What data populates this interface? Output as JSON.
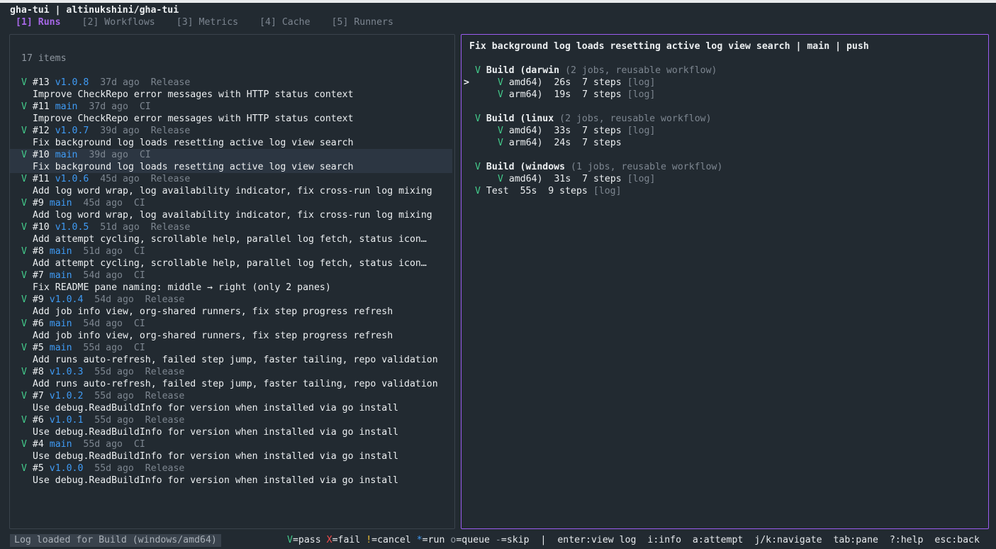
{
  "app_title": "gha-tui | altinukshini/gha-tui",
  "tabs": [
    {
      "label": "[1] Runs",
      "active": true
    },
    {
      "label": "[2] Workflows",
      "active": false
    },
    {
      "label": "[3] Metrics",
      "active": false
    },
    {
      "label": "[4] Cache",
      "active": false
    },
    {
      "label": "[5] Runners",
      "active": false
    }
  ],
  "runs": {
    "count_label": "17 items",
    "selected_index": 3,
    "items": [
      {
        "status": "V",
        "number": "#13",
        "ref": "v1.0.8",
        "age": "37d ago",
        "workflow": "Release",
        "message": "Improve CheckRepo error messages with HTTP status context"
      },
      {
        "status": "V",
        "number": "#11",
        "ref": "main",
        "age": "37d ago",
        "workflow": "CI",
        "message": "Improve CheckRepo error messages with HTTP status context"
      },
      {
        "status": "V",
        "number": "#12",
        "ref": "v1.0.7",
        "age": "39d ago",
        "workflow": "Release",
        "message": "Fix background log loads resetting active log view search"
      },
      {
        "status": "V",
        "number": "#10",
        "ref": "main",
        "age": "39d ago",
        "workflow": "CI",
        "message": "Fix background log loads resetting active log view search"
      },
      {
        "status": "V",
        "number": "#11",
        "ref": "v1.0.6",
        "age": "45d ago",
        "workflow": "Release",
        "message": "Add log word wrap, log availability indicator, fix cross-run log mixing"
      },
      {
        "status": "V",
        "number": "#9",
        "ref": "main",
        "age": "45d ago",
        "workflow": "CI",
        "message": "Add log word wrap, log availability indicator, fix cross-run log mixing"
      },
      {
        "status": "V",
        "number": "#10",
        "ref": "v1.0.5",
        "age": "51d ago",
        "workflow": "Release",
        "message": "Add attempt cycling, scrollable help, parallel log fetch, status icon…"
      },
      {
        "status": "V",
        "number": "#8",
        "ref": "main",
        "age": "51d ago",
        "workflow": "CI",
        "message": "Add attempt cycling, scrollable help, parallel log fetch, status icon…"
      },
      {
        "status": "V",
        "number": "#7",
        "ref": "main",
        "age": "54d ago",
        "workflow": "CI",
        "message": "Fix README pane naming: middle → right (only 2 panes)"
      },
      {
        "status": "V",
        "number": "#9",
        "ref": "v1.0.4",
        "age": "54d ago",
        "workflow": "Release",
        "message": "Add job info view, org-shared runners, fix step progress refresh"
      },
      {
        "status": "V",
        "number": "#6",
        "ref": "main",
        "age": "54d ago",
        "workflow": "CI",
        "message": "Add job info view, org-shared runners, fix step progress refresh"
      },
      {
        "status": "V",
        "number": "#5",
        "ref": "main",
        "age": "55d ago",
        "workflow": "CI",
        "message": "Add runs auto-refresh, failed step jump, faster tailing, repo validation"
      },
      {
        "status": "V",
        "number": "#8",
        "ref": "v1.0.3",
        "age": "55d ago",
        "workflow": "Release",
        "message": "Add runs auto-refresh, failed step jump, faster tailing, repo validation"
      },
      {
        "status": "V",
        "number": "#7",
        "ref": "v1.0.2",
        "age": "55d ago",
        "workflow": "Release",
        "message": "Use debug.ReadBuildInfo for version when installed via go install"
      },
      {
        "status": "V",
        "number": "#6",
        "ref": "v1.0.1",
        "age": "55d ago",
        "workflow": "Release",
        "message": "Use debug.ReadBuildInfo for version when installed via go install"
      },
      {
        "status": "V",
        "number": "#4",
        "ref": "main",
        "age": "55d ago",
        "workflow": "CI",
        "message": "Use debug.ReadBuildInfo for version when installed via go install"
      },
      {
        "status": "V",
        "number": "#5",
        "ref": "v1.0.0",
        "age": "55d ago",
        "workflow": "Release",
        "message": "Use debug.ReadBuildInfo for version when installed via go install"
      }
    ]
  },
  "detail": {
    "header": "Fix background log loads resetting active log view search | main | push",
    "cursor": ">",
    "groups": [
      {
        "status": "V",
        "name": "Build (darwin",
        "meta": "(2 jobs, reusable workflow)",
        "jobs": [
          {
            "status": "V",
            "name": "amd64)",
            "duration": "26s",
            "steps": "7 steps",
            "log": "[log]",
            "cursor": true
          },
          {
            "status": "V",
            "name": "arm64)",
            "duration": "19s",
            "steps": "7 steps",
            "log": "[log]",
            "cursor": false
          }
        ]
      },
      {
        "status": "V",
        "name": "Build (linux",
        "meta": "(2 jobs, reusable workflow)",
        "jobs": [
          {
            "status": "V",
            "name": "amd64)",
            "duration": "33s",
            "steps": "7 steps",
            "log": "[log]",
            "cursor": false
          },
          {
            "status": "V",
            "name": "arm64)",
            "duration": "24s",
            "steps": "7 steps",
            "log": "",
            "cursor": false
          }
        ]
      },
      {
        "status": "V",
        "name": "Build (windows",
        "meta": "(1 jobs, reusable workflow)",
        "jobs": [
          {
            "status": "V",
            "name": "amd64)",
            "duration": "31s",
            "steps": "7 steps",
            "log": "[log]",
            "cursor": false
          }
        ]
      }
    ],
    "standalone": [
      {
        "status": "V",
        "name": "Test",
        "duration": "55s",
        "steps": "9 steps",
        "log": "[log]"
      }
    ]
  },
  "statusbar": {
    "message": "Log loaded for Build (windows/amd64)",
    "legend": [
      {
        "symbol": "V",
        "text": "=pass",
        "color": "#43c98a"
      },
      {
        "symbol": "X",
        "text": "=fail",
        "color": "#ef4c4c"
      },
      {
        "symbol": "!",
        "text": "=cancel",
        "color": "#f0c236"
      },
      {
        "symbol": "*",
        "text": "=run",
        "color": "#3f9bf5"
      },
      {
        "symbol": "o",
        "text": "=queue",
        "color": "#8e969f"
      },
      {
        "symbol": "-",
        "text": "=skip",
        "color": "#8e969f"
      }
    ],
    "separator": "|",
    "keys": [
      "enter:view log",
      "i:info",
      "a:attempt",
      "j/k:navigate",
      "tab:pane",
      "?:help",
      "esc:back"
    ]
  }
}
